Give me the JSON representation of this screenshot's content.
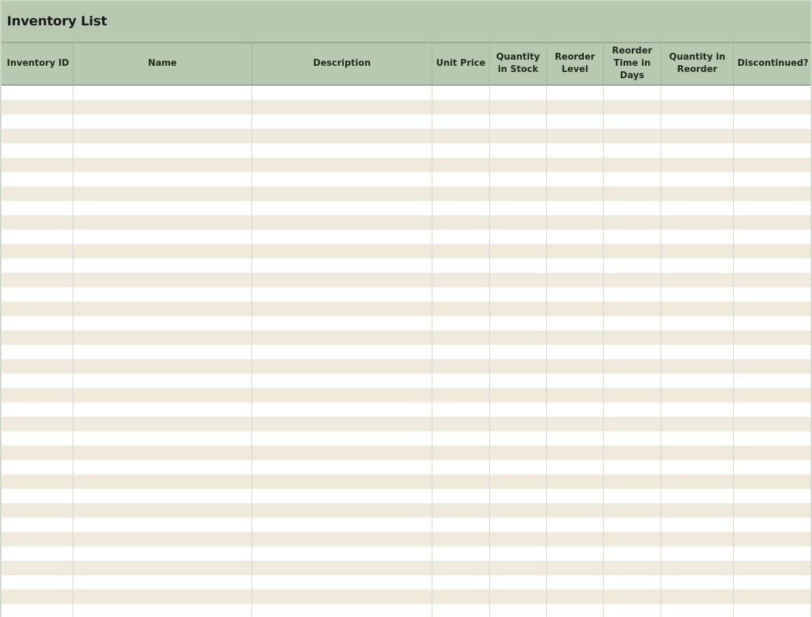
{
  "title": "Inventory List",
  "columns": [
    {
      "label": "Inventory ID"
    },
    {
      "label": "Name"
    },
    {
      "label": "Description"
    },
    {
      "label": "Unit Price"
    },
    {
      "label": "Quantity in Stock"
    },
    {
      "label": "Reorder Level"
    },
    {
      "label": "Reorder Time in Days"
    },
    {
      "label": "Quantity in Reorder"
    },
    {
      "label": "Discontinued?"
    }
  ],
  "colors": {
    "header_bg": "#b7c9b1",
    "band_light": "#ffffff",
    "band_tan": "#efeadc"
  }
}
